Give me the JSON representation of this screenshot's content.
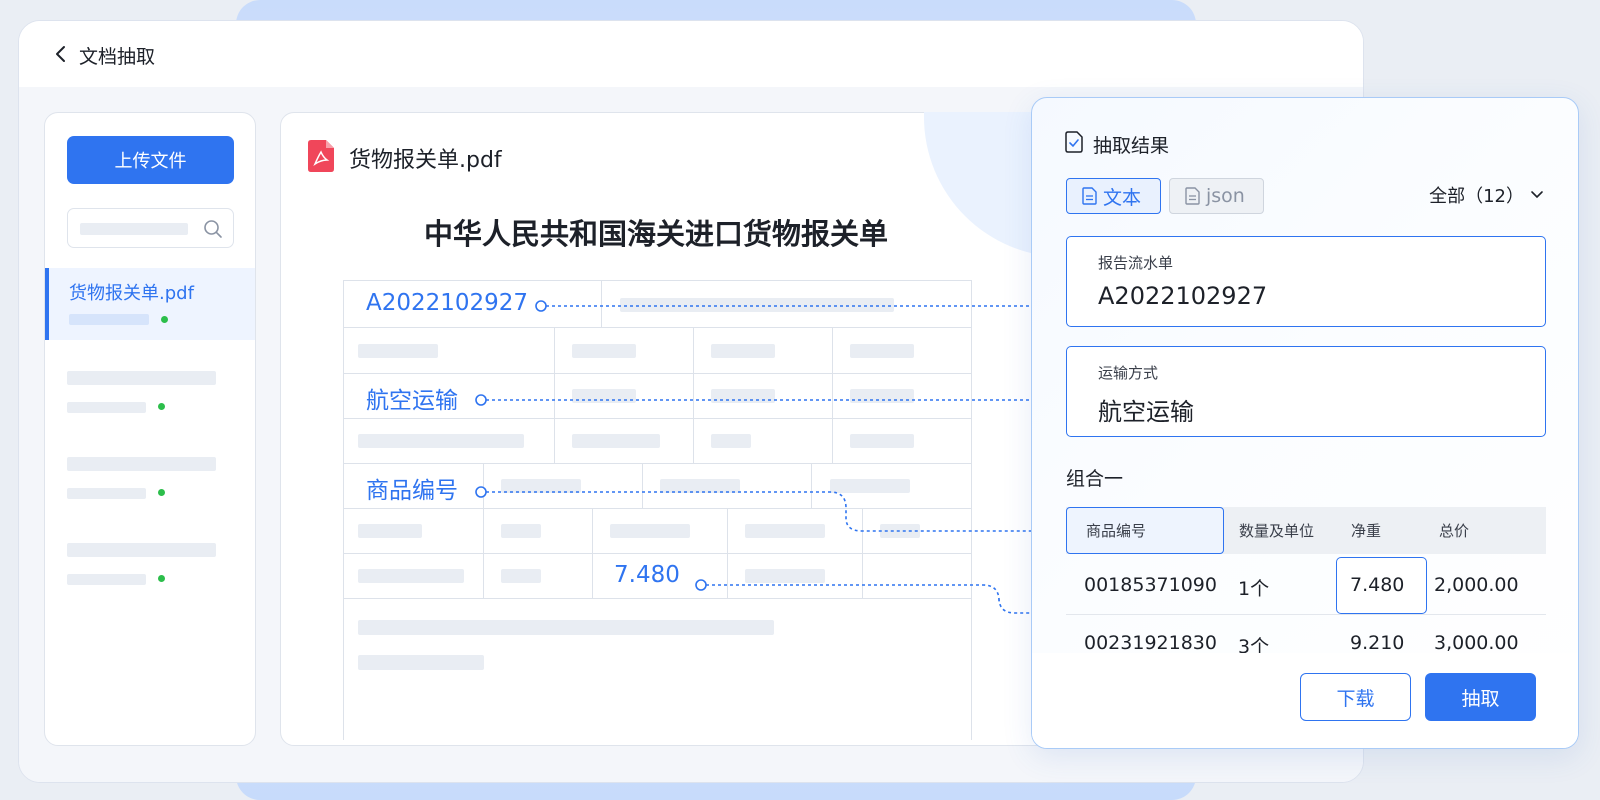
{
  "header": {
    "title": "文档抽取"
  },
  "sidebar": {
    "upload_label": "上传文件",
    "files": [
      {
        "name": "货物报关单.pdf"
      }
    ]
  },
  "document": {
    "file_name": "货物报关单.pdf",
    "heading": "中华人民共和国海关进口货物报关单",
    "highlights": {
      "report_no": "A2022102927",
      "transport": "航空运输",
      "product_code": "商品编号",
      "net_weight": "7.480"
    }
  },
  "results": {
    "title": "抽取结果",
    "tabs": [
      {
        "label": "文本"
      },
      {
        "label": "json"
      }
    ],
    "filter_label": "全部（12）",
    "fields": [
      {
        "label": "报告流水单",
        "value": "A2022102927"
      },
      {
        "label": "运输方式",
        "value": "航空运输"
      }
    ],
    "group": {
      "title": "组合一",
      "columns": [
        "商品编号",
        "数量及单位",
        "净重",
        "总价"
      ],
      "rows": [
        [
          "00185371090",
          "1个",
          "7.480",
          "2,000.00"
        ],
        [
          "00231921830",
          "3个",
          "9.210",
          "3,000.00"
        ]
      ]
    },
    "download_label": "下载",
    "extract_label": "抽取"
  },
  "colors": {
    "accent": "#2f74f0",
    "status_ok": "#2cbe4b",
    "pdf_red": "#f0465a"
  }
}
